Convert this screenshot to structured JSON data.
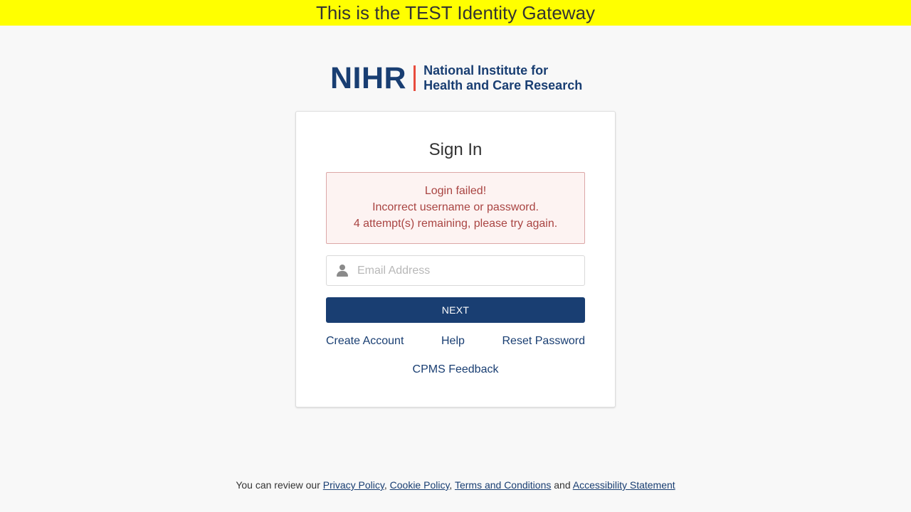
{
  "banner": {
    "text": "This is the TEST Identity Gateway",
    "color": "#ffff00"
  },
  "logo": {
    "mark": "NIHR",
    "line1": "National Institute for",
    "line2": "Health and Care Research",
    "brand_color": "#193e72",
    "accent_color": "#e84c3d"
  },
  "signin": {
    "title": "Sign In",
    "error": {
      "line1": "Login failed!",
      "line2": "Incorrect username or password.",
      "line3": "4 attempt(s) remaining, please try again."
    },
    "email": {
      "placeholder": "Email Address",
      "value": "",
      "icon": "user-icon"
    },
    "next_label": "NEXT",
    "links": {
      "create_account": "Create Account",
      "help": "Help",
      "reset_password": "Reset Password",
      "feedback": "CPMS Feedback"
    }
  },
  "footer": {
    "prefix": "You can review our",
    "privacy": "Privacy Policy",
    "sep1": ",",
    "cookie": "Cookie Policy",
    "sep2": ",",
    "terms": "Terms and Conditions",
    "and": "and",
    "accessibility": "Accessibility Statement"
  }
}
